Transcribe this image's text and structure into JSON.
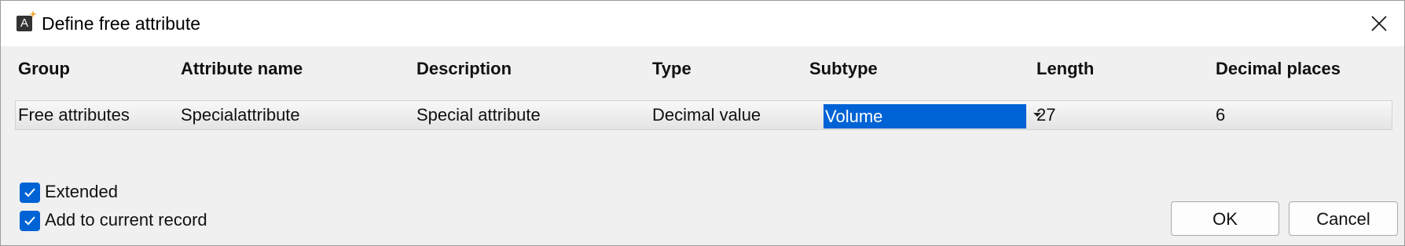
{
  "window": {
    "title": "Define free attribute",
    "app_icon_letter": "A"
  },
  "columns": [
    "Group",
    "Attribute name",
    "Description",
    "Type",
    "Subtype",
    "Length",
    "Decimal places"
  ],
  "row": {
    "group": "Free attributes",
    "attribute_name": "Specialattribute",
    "description": "Special attribute",
    "type": "Decimal value",
    "subtype": "Volume",
    "length": "27",
    "decimal_places": "6"
  },
  "options": {
    "extended": {
      "label": "Extended",
      "checked": true
    },
    "add_to_record": {
      "label": "Add to current record",
      "checked": true
    }
  },
  "buttons": {
    "ok": "OK",
    "cancel": "Cancel"
  },
  "colors": {
    "accent": "#0063d5",
    "dialog_bg": "#f0f0f0"
  }
}
